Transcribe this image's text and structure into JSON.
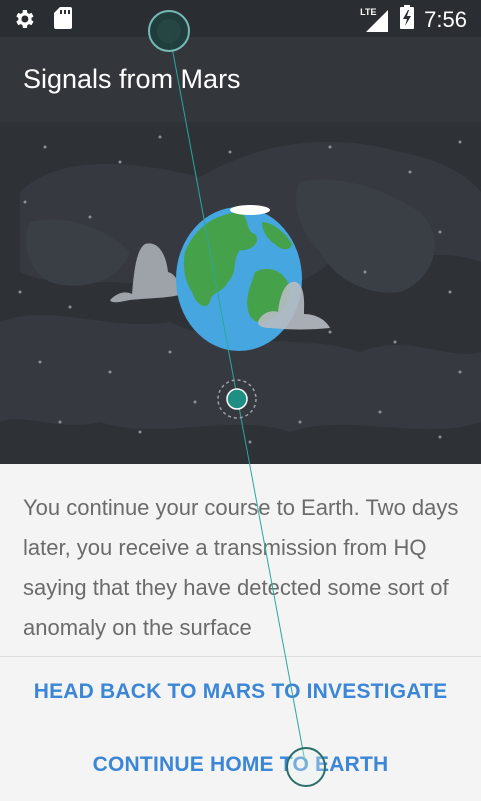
{
  "status_bar": {
    "time": "7:56",
    "network": "LTE",
    "icons": [
      "gear-icon",
      "sd-card-icon",
      "signal-icon",
      "battery-charging-icon"
    ]
  },
  "app_bar": {
    "title": "Signals from Mars"
  },
  "story": {
    "text": "You continue your course to Earth. Two days later, you receive a transmission from HQ saying that they have detected some sort of anomaly on the surface"
  },
  "choices": [
    {
      "label": "HEAD BACK TO MARS TO INVESTIGATE"
    },
    {
      "label": "CONTINUE HOME TO EARTH"
    }
  ],
  "colors": {
    "accent": "#3b86d6",
    "teal": "#1f8f86",
    "background_dark": "#2e3136"
  }
}
